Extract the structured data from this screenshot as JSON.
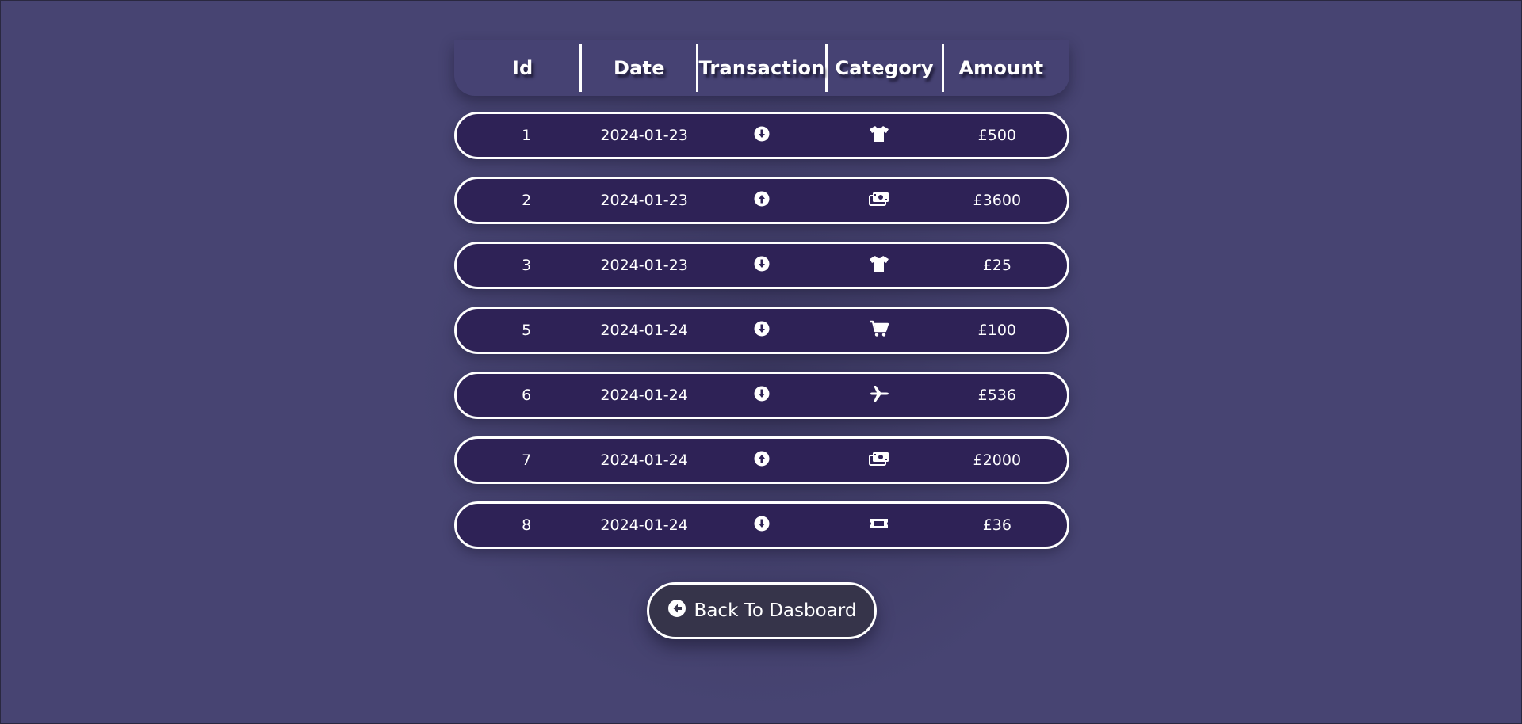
{
  "table": {
    "headers": [
      "Id",
      "Date",
      "Transaction",
      "Category",
      "Amount"
    ],
    "rows": [
      {
        "id": "1",
        "date": "2024-01-23",
        "transaction_icon": "arrow-down-circle-icon",
        "category_icon": "tshirt-icon",
        "amount": "£500"
      },
      {
        "id": "2",
        "date": "2024-01-23",
        "transaction_icon": "arrow-up-circle-icon",
        "category_icon": "money-icon",
        "amount": "£3600"
      },
      {
        "id": "3",
        "date": "2024-01-23",
        "transaction_icon": "arrow-down-circle-icon",
        "category_icon": "tshirt-icon",
        "amount": "£25"
      },
      {
        "id": "5",
        "date": "2024-01-24",
        "transaction_icon": "arrow-down-circle-icon",
        "category_icon": "cart-icon",
        "amount": "£100"
      },
      {
        "id": "6",
        "date": "2024-01-24",
        "transaction_icon": "arrow-down-circle-icon",
        "category_icon": "plane-icon",
        "amount": "£536"
      },
      {
        "id": "7",
        "date": "2024-01-24",
        "transaction_icon": "arrow-up-circle-icon",
        "category_icon": "money-icon",
        "amount": "£2000"
      },
      {
        "id": "8",
        "date": "2024-01-24",
        "transaction_icon": "arrow-down-circle-icon",
        "category_icon": "ticket-icon",
        "amount": "£36"
      }
    ]
  },
  "back_button": {
    "label": "Back To Dasboard",
    "icon": "arrow-left-circle-icon"
  },
  "colors": {
    "background": "#474472",
    "header_background": "#464273",
    "row_background": "#2e2256",
    "button_background": "#36344a",
    "border": "#ffffff",
    "text": "#ffffff"
  }
}
